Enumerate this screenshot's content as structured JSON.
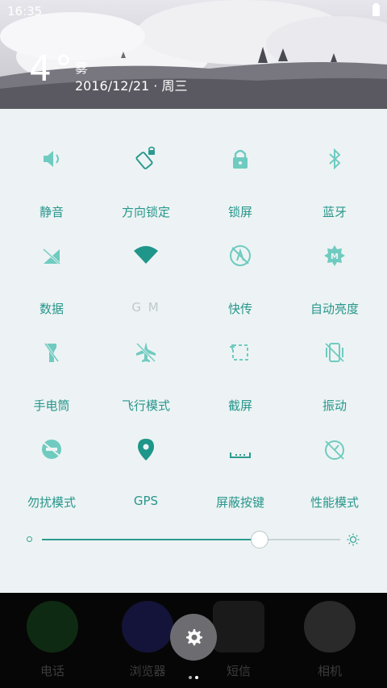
{
  "status_bar": {
    "time": "16:35"
  },
  "weather": {
    "temperature": "4°",
    "condition": "雾",
    "date": "2016/12/21 · 周三"
  },
  "tiles": [
    {
      "label": "静音",
      "icon": "speaker-icon"
    },
    {
      "label": "方向锁定",
      "icon": "rotation-lock-icon"
    },
    {
      "label": "锁屏",
      "icon": "lock-icon"
    },
    {
      "label": "蓝牙",
      "icon": "bluetooth-icon"
    },
    {
      "label": "数据",
      "icon": "mobile-data-off-icon"
    },
    {
      "label": "G   M",
      "icon": "wifi-icon"
    },
    {
      "label": "快传",
      "icon": "quick-transfer-icon"
    },
    {
      "label": "自动亮度",
      "icon": "auto-brightness-icon"
    },
    {
      "label": "手电筒",
      "icon": "flashlight-icon"
    },
    {
      "label": "飞行模式",
      "icon": "airplane-off-icon"
    },
    {
      "label": "截屏",
      "icon": "screenshot-icon"
    },
    {
      "label": "振动",
      "icon": "vibrate-off-icon"
    },
    {
      "label": "勿扰模式",
      "icon": "do-not-disturb-icon"
    },
    {
      "label": "GPS",
      "icon": "location-pin-icon"
    },
    {
      "label": "屏蔽按键",
      "icon": "block-keys-icon"
    },
    {
      "label": "性能模式",
      "icon": "performance-icon"
    }
  ],
  "brightness": {
    "level": 0.73
  },
  "dock": {
    "apps": [
      {
        "label": "电话",
        "icon": "phone-icon"
      },
      {
        "label": "浏览器",
        "icon": "browser-icon"
      },
      {
        "label": "短信",
        "icon": "messages-icon"
      },
      {
        "label": "相机",
        "icon": "camera-icon"
      }
    ],
    "page_indicator": {
      "pages": 2,
      "current": 2
    }
  }
}
